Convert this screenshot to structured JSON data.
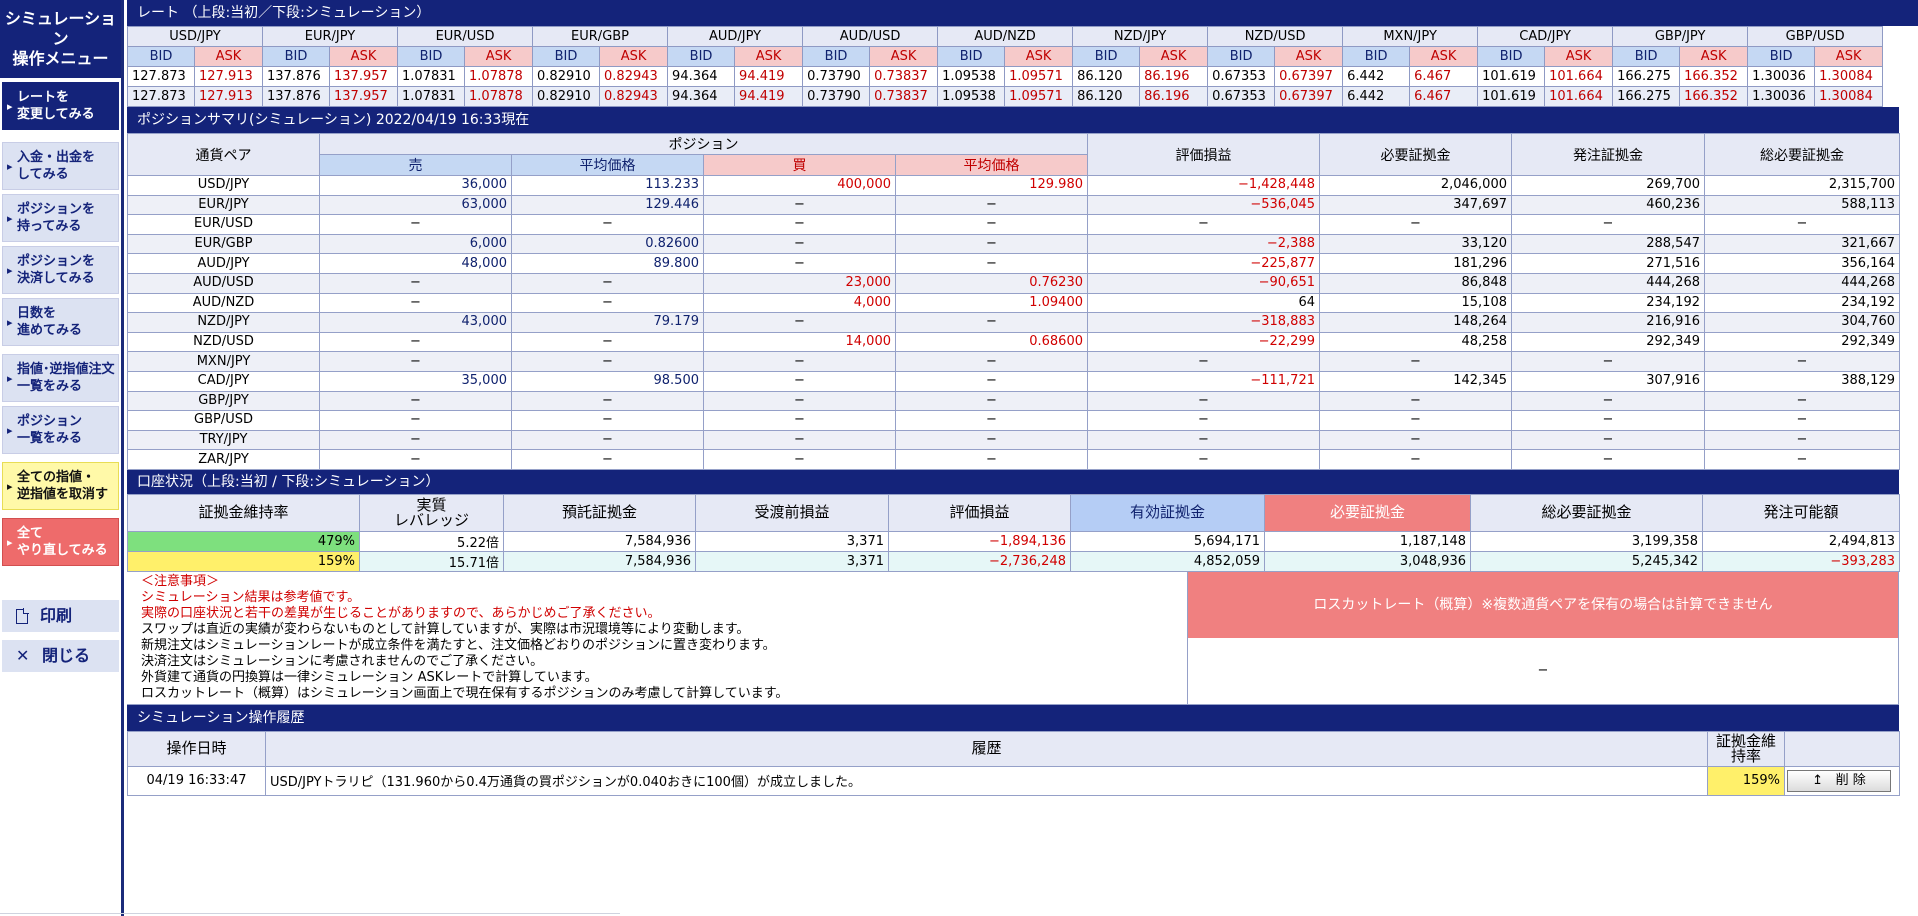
{
  "sidebar": {
    "title_line1": "シミュレーション",
    "title_line2": "操作メニュー",
    "buttons": [
      {
        "l1": "レートを",
        "l2": "変更してみる"
      },
      {
        "l1": "入金・出金を",
        "l2": "してみる"
      },
      {
        "l1": "ポジションを",
        "l2": "持ってみる"
      },
      {
        "l1": "ポジションを",
        "l2": "決済してみる"
      },
      {
        "l1": "日数を",
        "l2": "進めてみる"
      },
      {
        "l1": "指値･逆指値注文",
        "l2": "一覧をみる"
      },
      {
        "l1": "ポジション",
        "l2": "一覧をみる"
      },
      {
        "l1": "全ての指値・",
        "l2": "逆指値を取消す"
      },
      {
        "l1": "全て",
        "l2": "やり直してみる"
      }
    ],
    "print_label": "印刷",
    "close_label": "閉じる"
  },
  "rates": {
    "title": "レート （上段:当初／下段:シミュレーション）",
    "bid_label": "BID",
    "ask_label": "ASK",
    "pairs": [
      {
        "pair": "USD/JPY",
        "bid1": "127.873",
        "ask1": "127.913",
        "bid2": "127.873",
        "ask2": "127.913"
      },
      {
        "pair": "EUR/JPY",
        "bid1": "137.876",
        "ask1": "137.957",
        "bid2": "137.876",
        "ask2": "137.957"
      },
      {
        "pair": "EUR/USD",
        "bid1": "1.07831",
        "ask1": "1.07878",
        "bid2": "1.07831",
        "ask2": "1.07878"
      },
      {
        "pair": "EUR/GBP",
        "bid1": "0.82910",
        "ask1": "0.82943",
        "bid2": "0.82910",
        "ask2": "0.82943"
      },
      {
        "pair": "AUD/JPY",
        "bid1": "94.364",
        "ask1": "94.419",
        "bid2": "94.364",
        "ask2": "94.419"
      },
      {
        "pair": "AUD/USD",
        "bid1": "0.73790",
        "ask1": "0.73837",
        "bid2": "0.73790",
        "ask2": "0.73837"
      },
      {
        "pair": "AUD/NZD",
        "bid1": "1.09538",
        "ask1": "1.09571",
        "bid2": "1.09538",
        "ask2": "1.09571"
      },
      {
        "pair": "NZD/JPY",
        "bid1": "86.120",
        "ask1": "86.196",
        "bid2": "86.120",
        "ask2": "86.196"
      },
      {
        "pair": "NZD/USD",
        "bid1": "0.67353",
        "ask1": "0.67397",
        "bid2": "0.67353",
        "ask2": "0.67397"
      },
      {
        "pair": "MXN/JPY",
        "bid1": "6.442",
        "ask1": "6.467",
        "bid2": "6.442",
        "ask2": "6.467"
      },
      {
        "pair": "CAD/JPY",
        "bid1": "101.619",
        "ask1": "101.664",
        "bid2": "101.619",
        "ask2": "101.664"
      },
      {
        "pair": "GBP/JPY",
        "bid1": "166.275",
        "ask1": "166.352",
        "bid2": "166.275",
        "ask2": "166.352"
      },
      {
        "pair": "GBP/USD",
        "bid1": "1.30036",
        "ask1": "1.30084",
        "bid2": "1.30036",
        "ask2": "1.30084"
      }
    ]
  },
  "positions": {
    "title": "ポジションサマリ(シミュレーション) 2022/04/19 16:33現在",
    "headers": {
      "pair": "通貨ペア",
      "position": "ポジション",
      "sell": "売",
      "avg_price": "平均価格",
      "buy": "買",
      "pl": "評価損益",
      "required": "必要証拠金",
      "order": "発注証拠金",
      "total": "総必要証拠金"
    },
    "rows": [
      {
        "pair": "USD/JPY",
        "sell": "36,000",
        "sell_avg": "113.233",
        "buy": "400,000",
        "buy_avg": "129.980",
        "pl": "−1,428,448",
        "req": "2,046,000",
        "order": "269,700",
        "total": "2,315,700"
      },
      {
        "pair": "EUR/JPY",
        "sell": "63,000",
        "sell_avg": "129.446",
        "buy": "−",
        "buy_avg": "−",
        "pl": "−536,045",
        "req": "347,697",
        "order": "460,236",
        "total": "588,113"
      },
      {
        "pair": "EUR/USD",
        "sell": "−",
        "sell_avg": "−",
        "buy": "−",
        "buy_avg": "−",
        "pl": "−",
        "req": "−",
        "order": "−",
        "total": "−"
      },
      {
        "pair": "EUR/GBP",
        "sell": "6,000",
        "sell_avg": "0.82600",
        "buy": "−",
        "buy_avg": "−",
        "pl": "−2,388",
        "req": "33,120",
        "order": "288,547",
        "total": "321,667"
      },
      {
        "pair": "AUD/JPY",
        "sell": "48,000",
        "sell_avg": "89.800",
        "buy": "−",
        "buy_avg": "−",
        "pl": "−225,877",
        "req": "181,296",
        "order": "271,516",
        "total": "356,164"
      },
      {
        "pair": "AUD/USD",
        "sell": "−",
        "sell_avg": "−",
        "buy": "23,000",
        "buy_avg": "0.76230",
        "pl": "−90,651",
        "req": "86,848",
        "order": "444,268",
        "total": "444,268"
      },
      {
        "pair": "AUD/NZD",
        "sell": "−",
        "sell_avg": "−",
        "buy": "4,000",
        "buy_avg": "1.09400",
        "pl": "64",
        "req": "15,108",
        "order": "234,192",
        "total": "234,192"
      },
      {
        "pair": "NZD/JPY",
        "sell": "43,000",
        "sell_avg": "79.179",
        "buy": "−",
        "buy_avg": "−",
        "pl": "−318,883",
        "req": "148,264",
        "order": "216,916",
        "total": "304,760"
      },
      {
        "pair": "NZD/USD",
        "sell": "−",
        "sell_avg": "−",
        "buy": "14,000",
        "buy_avg": "0.68600",
        "pl": "−22,299",
        "req": "48,258",
        "order": "292,349",
        "total": "292,349"
      },
      {
        "pair": "MXN/JPY",
        "sell": "−",
        "sell_avg": "−",
        "buy": "−",
        "buy_avg": "−",
        "pl": "−",
        "req": "−",
        "order": "−",
        "total": "−"
      },
      {
        "pair": "CAD/JPY",
        "sell": "35,000",
        "sell_avg": "98.500",
        "buy": "−",
        "buy_avg": "−",
        "pl": "−111,721",
        "req": "142,345",
        "order": "307,916",
        "total": "388,129"
      },
      {
        "pair": "GBP/JPY",
        "sell": "−",
        "sell_avg": "−",
        "buy": "−",
        "buy_avg": "−",
        "pl": "−",
        "req": "−",
        "order": "−",
        "total": "−"
      },
      {
        "pair": "GBP/USD",
        "sell": "−",
        "sell_avg": "−",
        "buy": "−",
        "buy_avg": "−",
        "pl": "−",
        "req": "−",
        "order": "−",
        "total": "−"
      },
      {
        "pair": "TRY/JPY",
        "sell": "−",
        "sell_avg": "−",
        "buy": "−",
        "buy_avg": "−",
        "pl": "−",
        "req": "−",
        "order": "−",
        "total": "−"
      },
      {
        "pair": "ZAR/JPY",
        "sell": "−",
        "sell_avg": "−",
        "buy": "−",
        "buy_avg": "−",
        "pl": "−",
        "req": "−",
        "order": "−",
        "total": "−"
      }
    ]
  },
  "account": {
    "title": "口座状況（上段:当初 / 下段:シミュレーション）",
    "headers": {
      "margin_rate": "証拠金維持率",
      "leverage_l1": "実質",
      "leverage_l2": "レバレッジ",
      "deposit": "預託証拠金",
      "before_delivery": "受渡前損益",
      "pl": "評価損益",
      "effective": "有効証拠金",
      "required": "必要証拠金",
      "total_required": "総必要証拠金",
      "available": "発注可能額"
    },
    "rows": [
      {
        "margin_rate": "479%",
        "leverage": "5.22倍",
        "deposit": "7,584,936",
        "before": "3,371",
        "pl": "−1,894,136",
        "effective": "5,694,171",
        "required": "1,187,148",
        "total": "3,199,358",
        "available": "2,494,813"
      },
      {
        "margin_rate": "159%",
        "leverage": "15.71倍",
        "deposit": "7,584,936",
        "before": "3,371",
        "pl": "−2,736,248",
        "effective": "4,852,059",
        "required": "3,048,936",
        "total": "5,245,342",
        "available": "−393,283"
      }
    ]
  },
  "notes": {
    "heading": "＜注意事項＞",
    "red_lines": [
      "シミュレーション結果は参考値です。",
      "実際の口座状況と若干の差異が生じることがありますので、あらかじめご了承ください。"
    ],
    "lines": [
      "スワップは直近の実績が変わらないものとして計算していますが、実際は市況環境等により変動します。",
      "新規注文はシミュレーションレートが成立条件を満たすと、注文価格どおりのポジションに置き変わります。",
      "決済注文はシミュレーションに考慮されませんのでご了承ください。",
      "外貨建て通貨の円換算は一律シミュレーション ASKレートで計算しています。",
      "ロスカットレート（概算）はシミュレーション画面上で現在保有するポジションのみ考慮して計算しています。"
    ]
  },
  "losscut": {
    "header": "ロスカットレート（概算）※複数通貨ペアを保有の場合は計算できません",
    "value": "−"
  },
  "history": {
    "title": "シミュレーション操作履歴",
    "headers": {
      "datetime": "操作日時",
      "history": "履歴",
      "rate_l1": "証拠金維",
      "rate_l2": "持率"
    },
    "rows": [
      {
        "datetime": "04/19 16:33:47",
        "text": "USD/JPYトラリピ（131.960から0.4万通貨の買ポジションが0.040おきに100個）が成立しました。",
        "rate": "159%",
        "delete_label": "削 除"
      }
    ]
  },
  "colors": {
    "navy": "#14237a",
    "bid": "#c5d8f3",
    "ask": "#f6caca",
    "negative": "#d00000",
    "good_margin": "#7ee07e",
    "warn_margin": "#fff06a"
  }
}
